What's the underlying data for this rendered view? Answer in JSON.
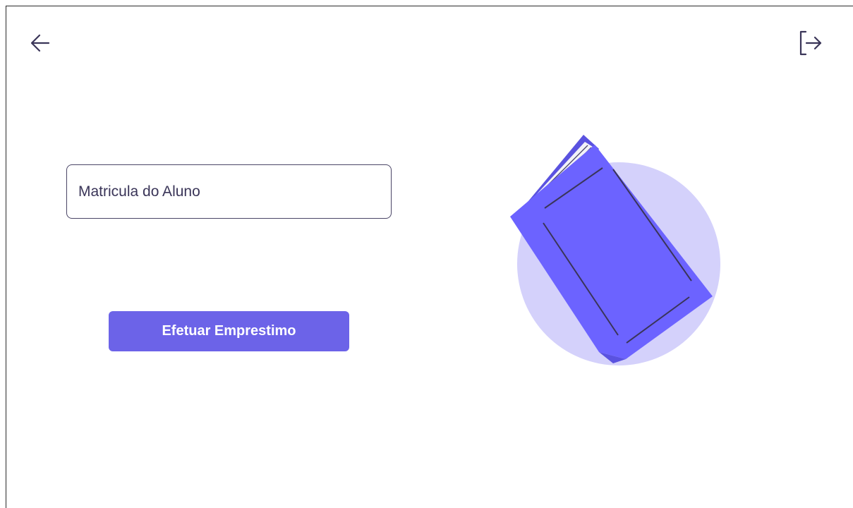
{
  "header": {
    "back_icon": "arrow-left-icon",
    "logout_icon": "logout-icon"
  },
  "form": {
    "matricula_placeholder": "Matricula do Aluno",
    "matricula_value": "",
    "submit_label": "Efetuar Emprestimo"
  },
  "illustration": {
    "icon": "book-icon"
  },
  "colors": {
    "accent": "#6c63e8",
    "book": "#6c63ff",
    "circle": "#d4d1fb",
    "icon_stroke": "#3a3558",
    "field_border": "#4a4566"
  }
}
